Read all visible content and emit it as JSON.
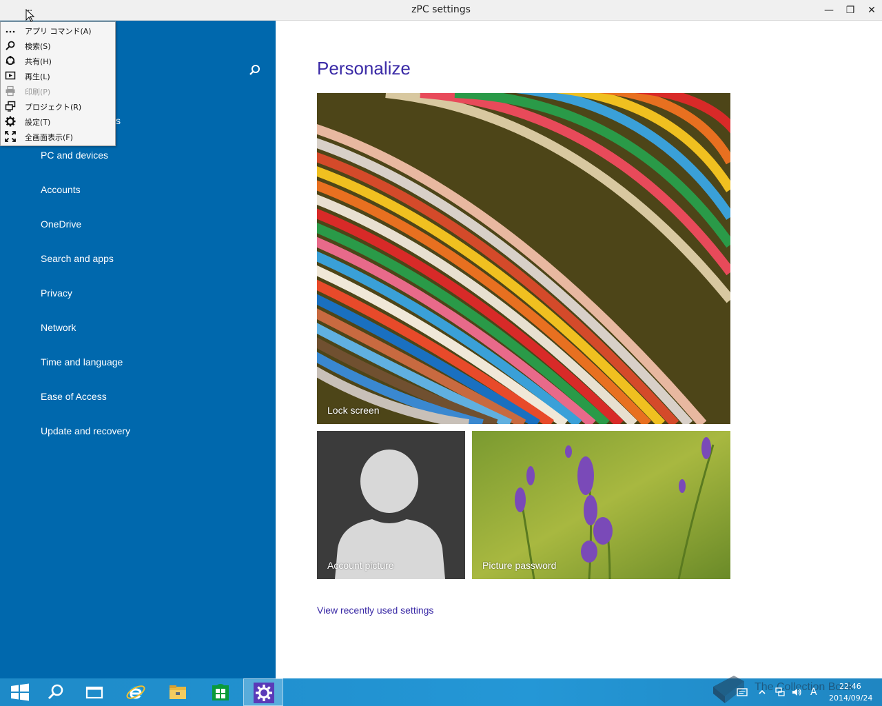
{
  "window": {
    "title": "zPC settings",
    "menu_dots": "...",
    "minimize": "—",
    "restore": "❐",
    "close": "✕"
  },
  "nav": {
    "fragment": "s",
    "items": [
      {
        "label": "PC and devices"
      },
      {
        "label": "Accounts"
      },
      {
        "label": "OneDrive"
      },
      {
        "label": "Search and apps"
      },
      {
        "label": "Privacy"
      },
      {
        "label": "Network"
      },
      {
        "label": "Time and language"
      },
      {
        "label": "Ease of Access"
      },
      {
        "label": "Update and recovery"
      }
    ]
  },
  "context_menu": {
    "items": [
      {
        "label": "アプリ コマンド(A)",
        "icon": "more-icon",
        "enabled": true
      },
      {
        "label": "検索(S)",
        "icon": "search-icon",
        "enabled": true
      },
      {
        "label": "共有(H)",
        "icon": "share-icon",
        "enabled": true
      },
      {
        "label": "再生(L)",
        "icon": "play-icon",
        "enabled": true
      },
      {
        "label": "印刷(P)",
        "icon": "print-icon",
        "enabled": false
      },
      {
        "label": "プロジェクト(R)",
        "icon": "project-icon",
        "enabled": true
      },
      {
        "label": "設定(T)",
        "icon": "gear-icon",
        "enabled": true
      },
      {
        "label": "全画面表示(F)",
        "icon": "fullscreen-icon",
        "enabled": true
      }
    ]
  },
  "main": {
    "heading": "Personalize",
    "tiles": {
      "lock_screen": "Lock screen",
      "account_picture": "Account picture",
      "picture_password": "Picture password"
    },
    "recent_link": "View recently used settings"
  },
  "taskbar": {
    "watermark": "The Collection Book",
    "ime": "A",
    "time": "22:46",
    "date": "2014/09/24"
  },
  "colors": {
    "nav_bg": "#0068ad",
    "accent": "#3a2aa6",
    "taskbar": "#2497d6"
  }
}
